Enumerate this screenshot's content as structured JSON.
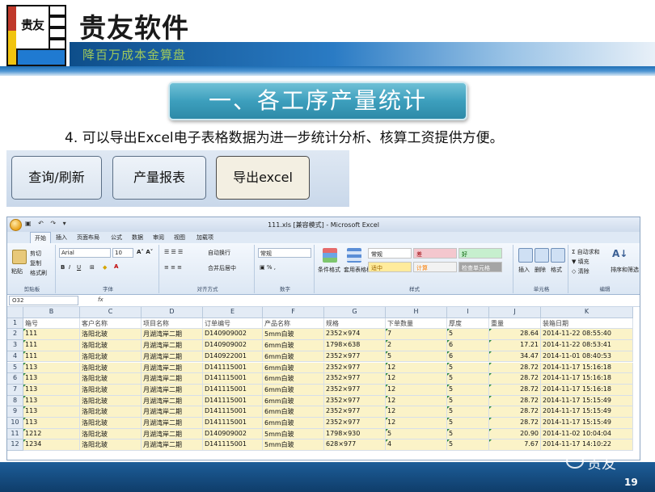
{
  "brand": {
    "logo_glyph": "贵友",
    "title": "贵友软件",
    "subtitle": "降百万成本金算盘"
  },
  "section_title": "一、各工序产量统计",
  "subtitle_text": "4. 可以导出Excel电子表格数据为进一步统计分析、核算工资提供方便。",
  "buttons": [
    {
      "label": "查询/刷新"
    },
    {
      "label": "产量报表"
    },
    {
      "label": "导出excel"
    }
  ],
  "excel": {
    "qat": "▣ ↶ ↷ ▾",
    "window_title": "111.xls [兼容模式] - Microsoft Excel",
    "tabs": [
      "开始",
      "插入",
      "页面布局",
      "公式",
      "数据",
      "审阅",
      "视图",
      "加载项"
    ],
    "ribbon": {
      "clipboard": {
        "cut": "剪切",
        "copy": "复制",
        "format_painter": "格式刷",
        "paste": "粘贴",
        "label": "剪贴板"
      },
      "font": {
        "name": "Arial",
        "size": "10",
        "bold": "B",
        "italic": "I",
        "underline": "U",
        "label": "字体"
      },
      "alignment": {
        "wrap": "自动换行",
        "merge": "合并后居中",
        "label": "对齐方式"
      },
      "number": {
        "format": "常规",
        "label": "数字"
      },
      "styles": {
        "conditional": "条件格式",
        "table": "套用表格格式",
        "label": "样式",
        "cells": [
          {
            "text": "常规",
            "color": "#ffffff",
            "fg": "#111111"
          },
          {
            "text": "差",
            "color": "#f4c7ce",
            "fg": "#9c0006"
          },
          {
            "text": "好",
            "color": "#c6efce",
            "fg": "#006100"
          },
          {
            "text": "适中",
            "color": "#ffeb9c",
            "fg": "#9c6500"
          },
          {
            "text": "计算",
            "color": "#f2f2f2",
            "fg": "#fa7d00"
          },
          {
            "text": "检查单元格",
            "color": "#a5a5a5",
            "fg": "#ffffff"
          }
        ]
      },
      "cells": {
        "insert": "插入",
        "delete": "删除",
        "format": "格式",
        "label": "单元格"
      },
      "editing": {
        "autosum": "自动求和",
        "fill": "填充",
        "clear": "清除",
        "sort": "排序和筛选",
        "label": "编辑"
      }
    },
    "namebox": "O32",
    "fx": "fx",
    "columns": [
      "B",
      "C",
      "D",
      "E",
      "F",
      "G",
      "H",
      "I",
      "J",
      "K"
    ],
    "header_row": [
      "箱号",
      "客户名称",
      "项目名称",
      "订单编号",
      "产品名称",
      "规格",
      "下单数量",
      "厚度",
      "重量",
      "装箱日期"
    ],
    "rows": [
      [
        "1",
        "111",
        "洛阳北玻",
        "月湖湾岸二期",
        "D140909002",
        "5mm白玻",
        "2352×974",
        "7",
        "5",
        "28.64",
        "2014-11-22 08:55:40"
      ],
      [
        "2",
        "111",
        "洛阳北玻",
        "月湖湾岸二期",
        "D140909002",
        "6mm白玻",
        "1798×638",
        "2",
        "6",
        "17.21",
        "2014-11-22 08:53:41"
      ],
      [
        "3",
        "111",
        "洛阳北玻",
        "月湖湾岸二期",
        "D140922001",
        "6mm白玻",
        "2352×977",
        "5",
        "6",
        "34.47",
        "2014-11-01 08:40:53"
      ],
      [
        "4",
        "113",
        "洛阳北玻",
        "月湖湾岸二期",
        "D141115001",
        "6mm白玻",
        "2352×977",
        "12",
        "5",
        "28.72",
        "2014-11-17 15:16:18"
      ],
      [
        "5",
        "113",
        "洛阳北玻",
        "月湖湾岸二期",
        "D141115001",
        "6mm白玻",
        "2352×977",
        "12",
        "5",
        "28.72",
        "2014-11-17 15:16:18"
      ],
      [
        "6",
        "113",
        "洛阳北玻",
        "月湖湾岸二期",
        "D141115001",
        "6mm白玻",
        "2352×977",
        "12",
        "5",
        "28.72",
        "2014-11-17 15:16:18"
      ],
      [
        "7",
        "113",
        "洛阳北玻",
        "月湖湾岸二期",
        "D141115001",
        "6mm白玻",
        "2352×977",
        "12",
        "5",
        "28.72",
        "2014-11-17 15:15:49"
      ],
      [
        "8",
        "113",
        "洛阳北玻",
        "月湖湾岸二期",
        "D141115001",
        "6mm白玻",
        "2352×977",
        "12",
        "5",
        "28.72",
        "2014-11-17 15:15:49"
      ],
      [
        "9",
        "113",
        "洛阳北玻",
        "月湖湾岸二期",
        "D141115001",
        "6mm白玻",
        "2352×977",
        "12",
        "5",
        "28.72",
        "2014-11-17 15:15:49"
      ],
      [
        "10",
        "1212",
        "洛阳北玻",
        "月湖湾岸二期",
        "D140909002",
        "5mm白玻",
        "1798×930",
        "5",
        "5",
        "20.90",
        "2014-11-02 10:04:04"
      ],
      [
        "11",
        "1234",
        "洛阳北玻",
        "月湖湾岸二期",
        "D141115001",
        "5mm白玻",
        "628×977",
        "4",
        "5",
        "7.67",
        "2014-11-17 14:10:22"
      ]
    ]
  },
  "watermark": "贵友",
  "page_number": "19"
}
